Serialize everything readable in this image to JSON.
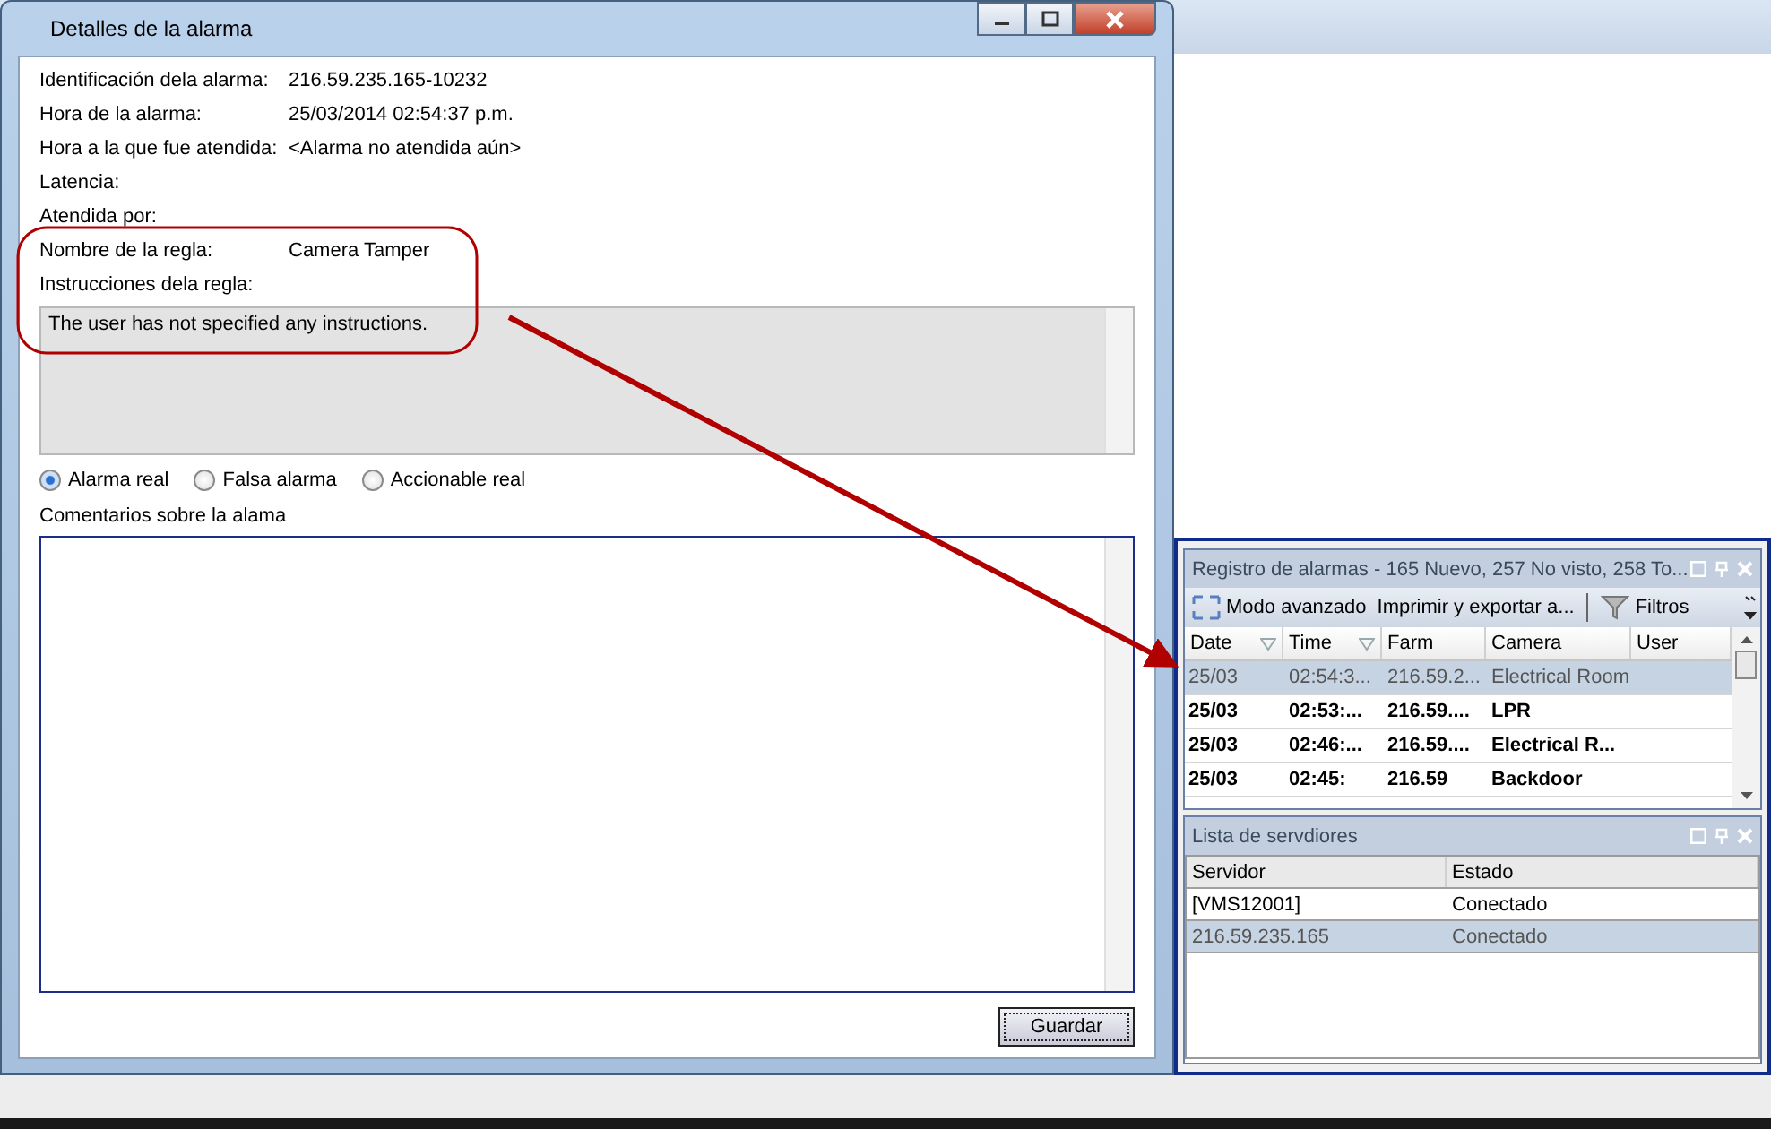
{
  "dialog": {
    "title": "Detalles de la alarma",
    "fields": [
      {
        "label": "Identificación dela alarma:",
        "value": "216.59.235.165-10232"
      },
      {
        "label": "Hora de la alarma:",
        "value": "25/03/2014 02:54:37 p.m."
      },
      {
        "label": "Hora a la que fue atendida:",
        "value": "<Alarma no atendida aún>"
      },
      {
        "label": "Latencia:"
      },
      {
        "label": "Atendida por:"
      },
      {
        "label": "Nombre de la regla:",
        "value": "Camera Tamper"
      },
      {
        "label": "Instrucciones dela regla:"
      }
    ],
    "instructions": "The user has not specified any instructions.",
    "radios": [
      {
        "label": "Alarma real",
        "selected": true
      },
      {
        "label": "Falsa alarma",
        "selected": false
      },
      {
        "label": "Accionable real",
        "selected": false
      }
    ],
    "comments_label": "Comentarios sobre la alama",
    "save_button": "Guardar"
  },
  "alarm_log": {
    "title": "Registro de alarmas - 165 Nuevo, 257 No visto, 258 To...",
    "toolbar": [
      {
        "kind": "expand",
        "label": "Modo avanzado"
      },
      {
        "kind": "plain",
        "label": "Imprimir y exportar a..."
      },
      {
        "kind": "filter",
        "label": "Filtros"
      }
    ],
    "columns": [
      {
        "label": "Date",
        "filter": true
      },
      {
        "label": "Time",
        "filter": true
      },
      {
        "label": "Farm",
        "filter": false
      },
      {
        "label": "Camera",
        "filter": false
      },
      {
        "label": "User",
        "filter": false
      }
    ],
    "rows": [
      {
        "cells": [
          "25/03",
          "02:54:3...",
          "216.59.2...",
          "Electrical Room"
        ],
        "selected": true,
        "unseen": false
      },
      {
        "cells": [
          "25/03",
          "02:53:...",
          "216.59....",
          "LPR"
        ],
        "selected": false,
        "unseen": true
      },
      {
        "cells": [
          "25/03",
          "02:46:...",
          "216.59....",
          "Electrical R..."
        ],
        "selected": false,
        "unseen": true
      },
      {
        "cells": [
          "25/03",
          "02:45:",
          "216.59",
          "Backdoor"
        ],
        "selected": false,
        "unseen": true
      }
    ]
  },
  "server_list": {
    "title": "Lista de servdiores",
    "columns": [
      "Servidor",
      "Estado"
    ],
    "rows": [
      {
        "cells": [
          "[VMS12001]",
          "Conectado"
        ],
        "selected": false
      },
      {
        "cells": [
          "216.59.235.165",
          "Conectado"
        ],
        "selected": true
      }
    ]
  }
}
